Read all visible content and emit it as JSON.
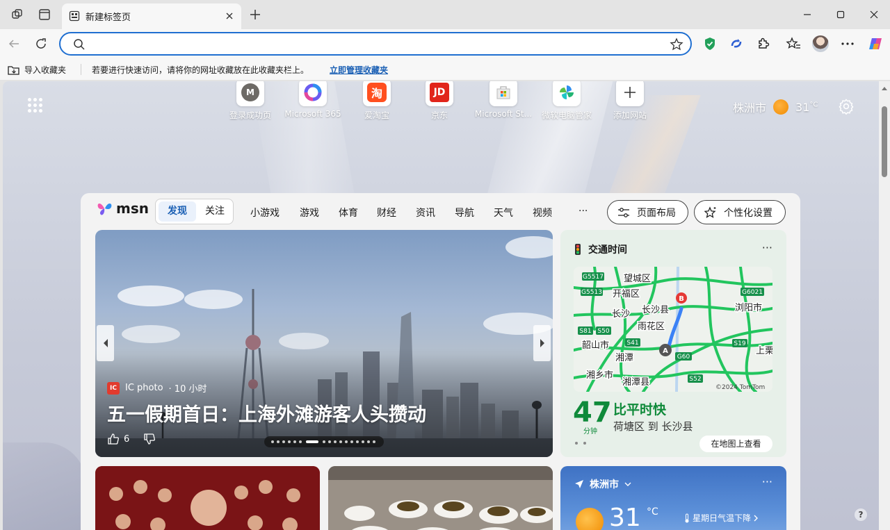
{
  "tab": {
    "title": "新建标签页"
  },
  "omnibox": {
    "value": "",
    "placeholder": ""
  },
  "favbar": {
    "import_label": "导入收藏夹",
    "hint": "若要进行快速访问，请将你的网址收藏放在此收藏夹栏上。",
    "manage_link": "立即管理收藏夹"
  },
  "quicklinks": [
    {
      "label": "登录成功页",
      "glyph": "M"
    },
    {
      "label": "Microsoft 365",
      "glyph": ""
    },
    {
      "label": "爱淘宝",
      "glyph": "淘"
    },
    {
      "label": "京东",
      "glyph": "JD"
    },
    {
      "label": "Microsoft St...",
      "glyph": ""
    },
    {
      "label": "微软电脑管家",
      "glyph": ""
    },
    {
      "label": "添加网站",
      "glyph": "+"
    }
  ],
  "weather_top": {
    "city": "株洲市",
    "temp": "31",
    "unit": "°C"
  },
  "msn": {
    "logo": "msn",
    "toggle": [
      "发现",
      "关注"
    ],
    "nav": [
      "小游戏",
      "游戏",
      "体育",
      "财经",
      "资讯",
      "导航",
      "天气",
      "视频",
      "···"
    ],
    "layout_button": "页面布局",
    "personalize_button": "个性化设置"
  },
  "hero": {
    "source_badge": "IC",
    "source": "IC photo",
    "time": "· 10 小时",
    "headline": "五一假期首日：上海外滩游客人头攒动",
    "likes": "6"
  },
  "traffic": {
    "title": "交通时间",
    "more": "···",
    "minutes": "47",
    "minutes_unit": "分钟",
    "status": "比平时快",
    "route": "荷塘区 到 长沙县",
    "view_map": "在地图上查看",
    "map_labels": {
      "a": "望城区",
      "b": "开福区",
      "c": "长沙县",
      "d": "长沙",
      "e": "雨花区",
      "f": "浏阳市",
      "g": "韶山市",
      "h": "湘潭",
      "i": "湘乡市",
      "j": "湘潭县",
      "k": "上栗",
      "s1": "G5517",
      "s2": "G5513",
      "s3": "G6021",
      "s4": "S81",
      "s5": "S50",
      "s6": "S41",
      "s7": "G60",
      "s8": "S19",
      "s9": "S52",
      "copyright": "©2024 TomTom"
    }
  },
  "weather_card": {
    "city": "株洲市",
    "more": "···",
    "temp": "31",
    "unit": "°C",
    "note": "星期日气温下降"
  },
  "colors": {
    "accent": "#1f6fd1",
    "traffic_green": "#0f8a3a",
    "map_road": "#22c55e"
  }
}
